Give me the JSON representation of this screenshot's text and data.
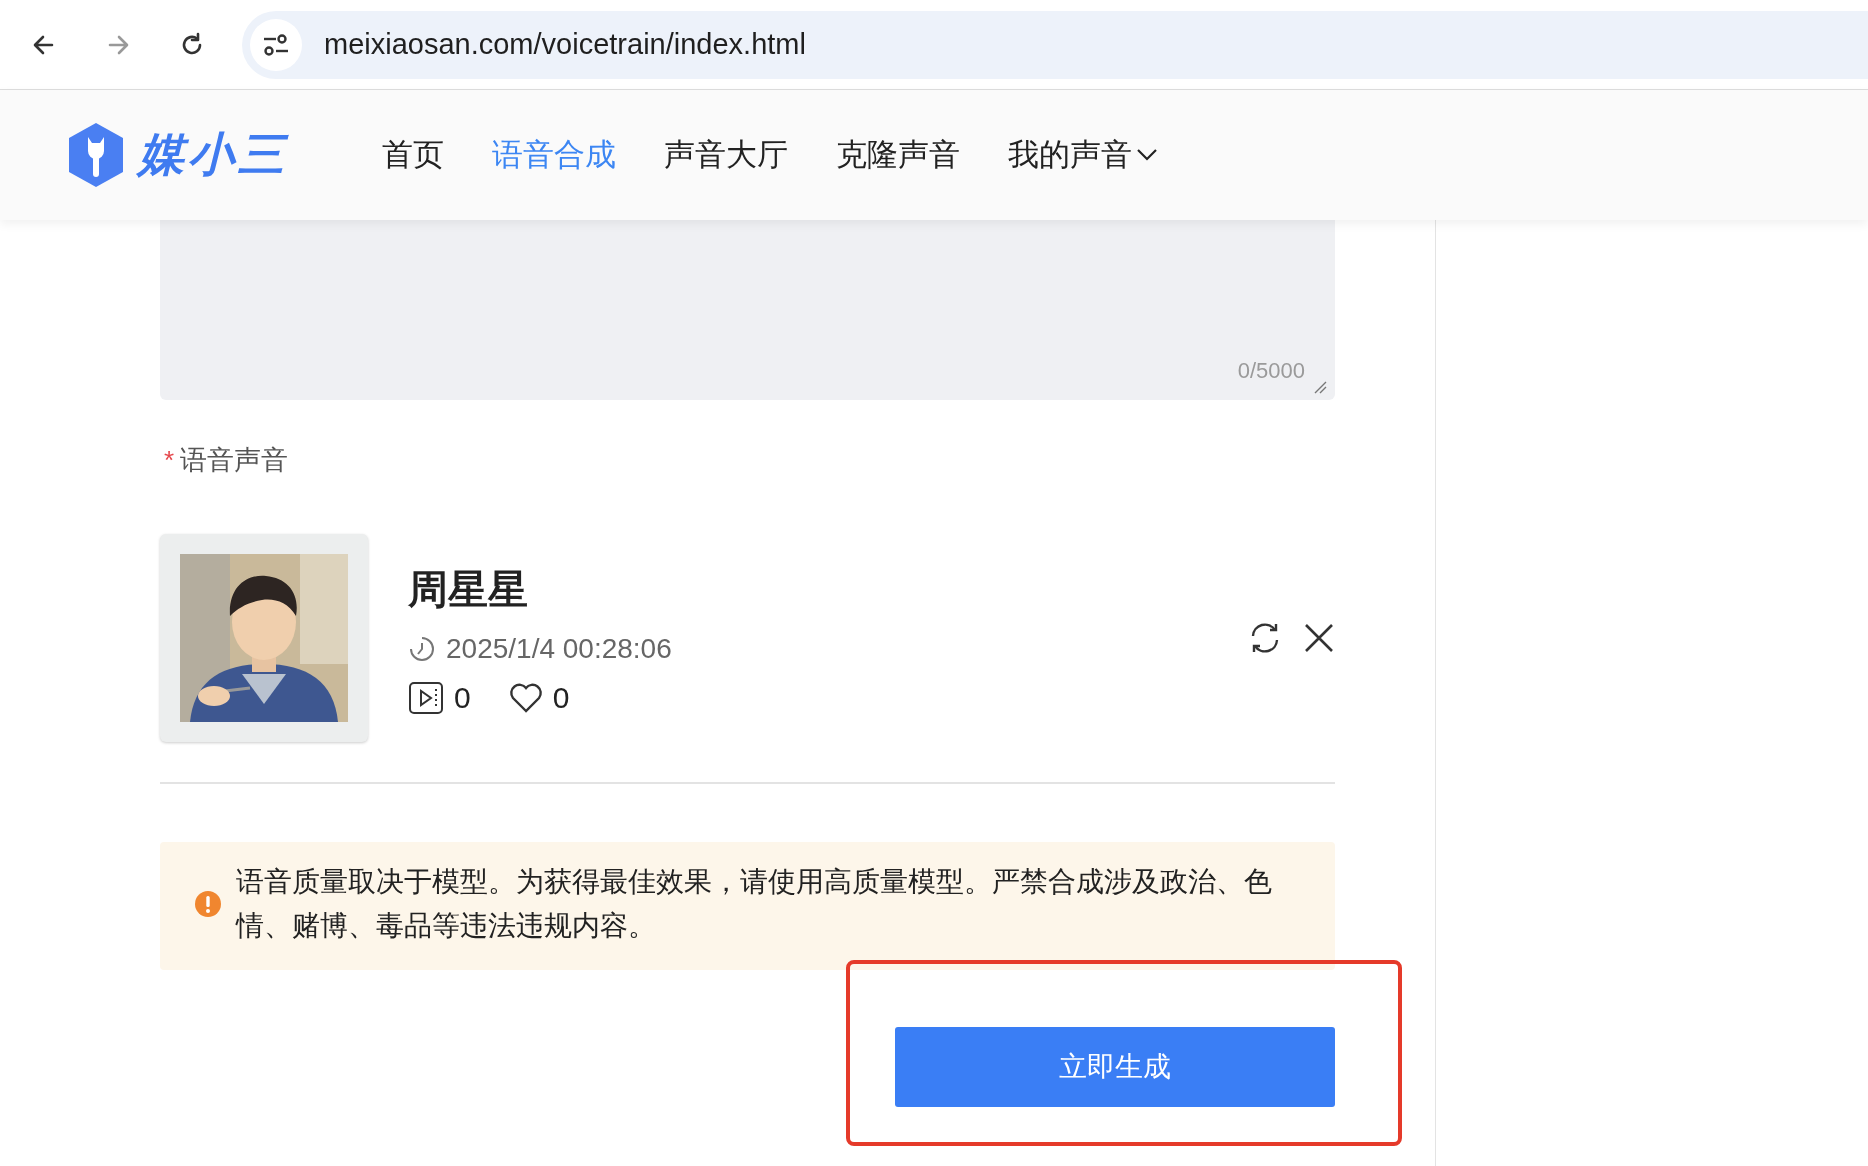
{
  "browser": {
    "url": "meixiaosan.com/voicetrain/index.html"
  },
  "header": {
    "logo_text": "媒小三",
    "nav": [
      {
        "label": "首页",
        "selected": false,
        "kind": "link"
      },
      {
        "label": "语音合成",
        "selected": true,
        "kind": "link"
      },
      {
        "label": "声音大厅",
        "selected": false,
        "kind": "link"
      },
      {
        "label": "克隆声音",
        "selected": false,
        "kind": "link"
      },
      {
        "label": "我的声音",
        "selected": false,
        "kind": "dropdown"
      }
    ]
  },
  "text_input": {
    "counter": "0/5000"
  },
  "voice_field": {
    "required_mark": "*",
    "label": "语音声音"
  },
  "voice": {
    "name": "周星星",
    "date": "2025/1/4 00:28:06",
    "plays": "0",
    "likes": "0"
  },
  "notice": {
    "text": "语音质量取决于模型。为获得最佳效果，请使用高质量模型。严禁合成涉及政治、色情、赌博、毒品等违法违规内容。"
  },
  "generate_button": {
    "label": "立即生成",
    "highlighted": true
  }
}
